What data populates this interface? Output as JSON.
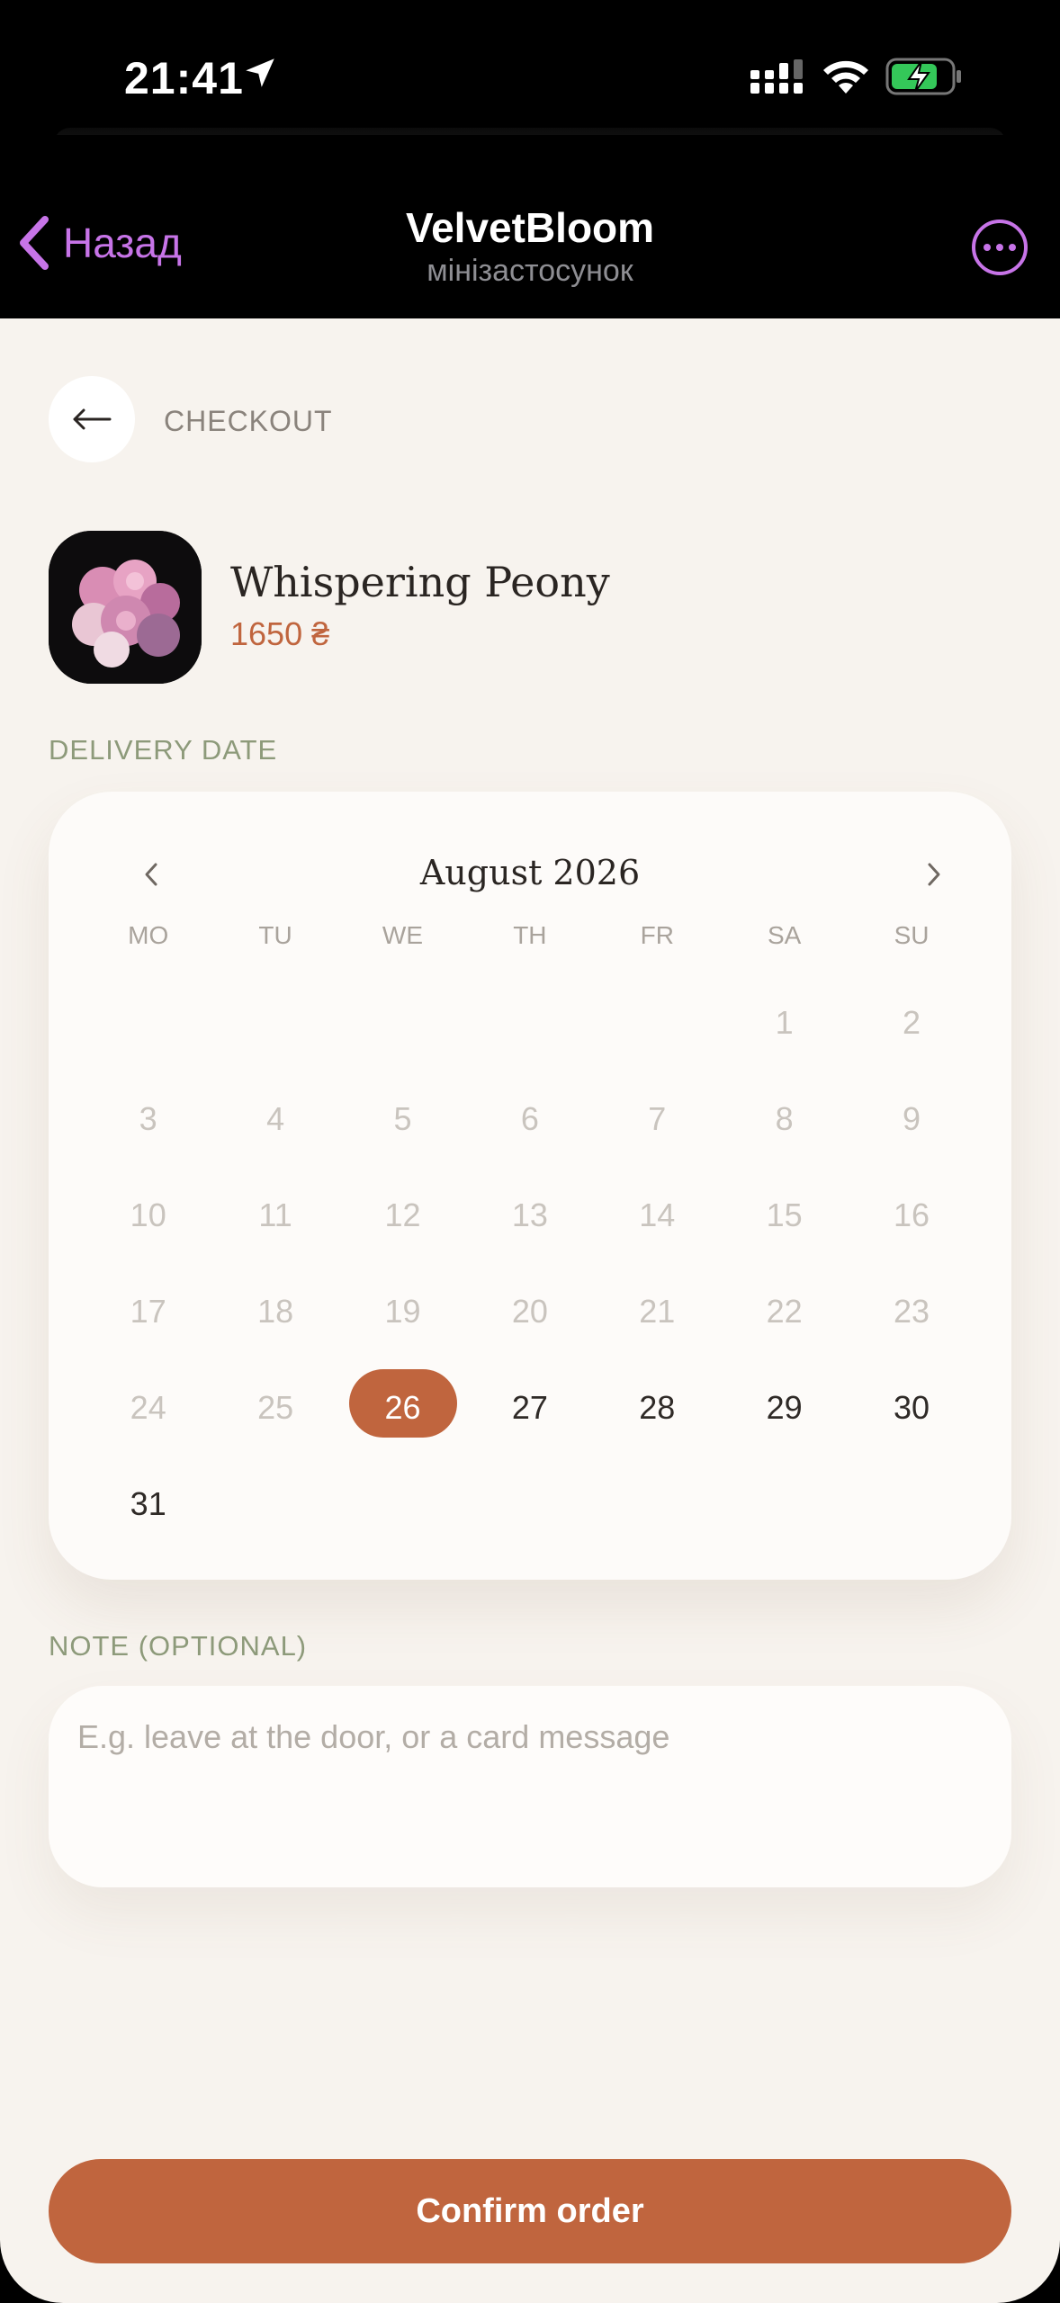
{
  "status_bar": {
    "time": "21:41"
  },
  "header": {
    "back_label": "Назад",
    "title": "VelvetBloom",
    "subtitle": "мінізастосунок"
  },
  "page": {
    "title": "CHECKOUT"
  },
  "product": {
    "name": "Whispering Peony",
    "price": "1650 ₴"
  },
  "delivery": {
    "label": "DELIVERY DATE"
  },
  "calendar": {
    "month": "August 2026",
    "weekdays": [
      "MO",
      "TU",
      "WE",
      "TH",
      "FR",
      "SA",
      "SU"
    ],
    "leading_blanks": 5,
    "days_in_month": 31,
    "first_available": 26,
    "selected": 26
  },
  "note": {
    "label": "NOTE (OPTIONAL)",
    "placeholder": "E.g. leave at the door, or a card message"
  },
  "confirm": {
    "label": "Confirm order"
  },
  "colors": {
    "accent": "#c0653e",
    "sage": "#8d9a7a",
    "telegram_purple": "#c774e8",
    "background": "#f7f3ee"
  }
}
